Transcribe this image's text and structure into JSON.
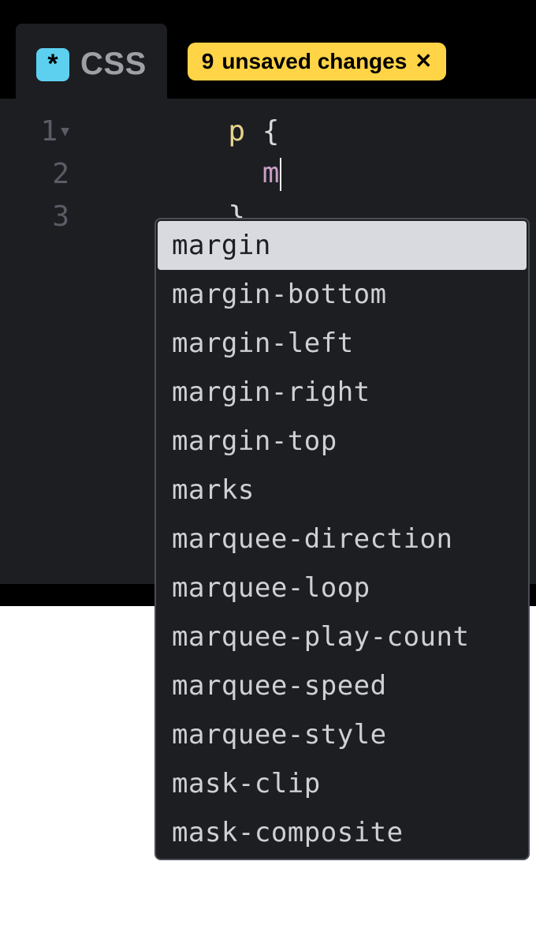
{
  "tab": {
    "icon_glyph": "*",
    "label": "CSS"
  },
  "unsaved": {
    "count": "9",
    "text": "unsaved changes",
    "close_glyph": "✕"
  },
  "code": {
    "lines": [
      {
        "num": "1",
        "selector": "p",
        "brace": "{"
      },
      {
        "num": "2",
        "indent": "  ",
        "prop": "m"
      },
      {
        "num": "3",
        "brace": "}"
      }
    ]
  },
  "autocomplete": {
    "items": [
      "margin",
      "margin-bottom",
      "margin-left",
      "margin-right",
      "margin-top",
      "marks",
      "marquee-direction",
      "marquee-loop",
      "marquee-play-count",
      "marquee-speed",
      "marquee-style",
      "mask-clip",
      "mask-composite"
    ],
    "selected_index": 0
  }
}
